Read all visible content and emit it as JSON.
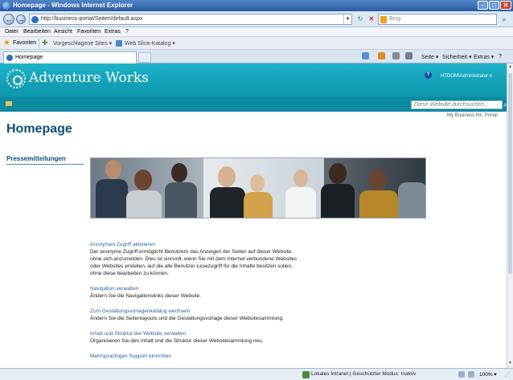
{
  "window": {
    "title": "Homepage - Windows Internet Explorer",
    "minimize": "–",
    "maximize": "□",
    "close": "✕"
  },
  "address_bar": {
    "back_icon": "←",
    "forward_icon": "→",
    "url": "http://business-portal/Seiten/default.aspx",
    "search_placeholder": "Bing",
    "refresh_icon": "↻",
    "stop_icon": "✕",
    "search_go_icon": "⌕"
  },
  "menu": [
    "Datei",
    "Bearbeiten",
    "Ansicht",
    "Favoriten",
    "Extras",
    "?"
  ],
  "favorites_bar": {
    "favorites_label": "Favoriten",
    "suggested_sites": "Vorgeschlagene Sites ▾",
    "web_slice": "Web Slice-Katalog ▾"
  },
  "tab": {
    "label": "Homepage"
  },
  "command_bar": {
    "page": "Seite ▾",
    "safety": "Sicherheit ▾",
    "tools": "Extras ▾",
    "help": "?"
  },
  "site": {
    "name": "Adventure Works",
    "user": "HTDOM\\Administrator ▾",
    "help_icon": "?",
    "search_placeholder": "Diese Website durchsuchen...",
    "search_go_icon": "⌕",
    "portal_link": "My Business Inc. Portal",
    "page_title": "Homepage",
    "left_nav_heading": "Pressemitteilungen"
  },
  "content_items": [
    {
      "heading": "Anonymen Zugriff aktivieren",
      "description": "Der anonyme Zugriff ermöglicht Benutzern das Anzeigen der Seiten auf dieser Website, ohne sich anzumelden. Dies ist sinnvoll, wenn Sie mit dem Internet verbundene Websites oder Websites erstellen, auf die alle Benutzer Lesezugriff für die Inhalte besitzen sollen, ohne diese bearbeiten zu können."
    },
    {
      "heading": "Navigation verwalten",
      "description": "Ändern Sie die Navigationslinks dieser Website."
    },
    {
      "heading": "Zum Gestaltungsvorlagenkatalog wechseln",
      "description": "Ändern Sie die Seitenlayouts und die Gestaltungsvorlage dieser Websitesammlung."
    },
    {
      "heading": "Inhalt und Struktur der Website verwalten",
      "description": "Organisieren Sie den Inhalt und die Struktur dieser Websitesammlung neu."
    },
    {
      "heading": "Mehrsprachigen Support einrichten",
      "description": ""
    }
  ],
  "status_bar": {
    "zone": "Lokales Intranet | Geschützter Modus: Inaktiv",
    "zoom": "100% ▾"
  },
  "colors": {
    "banner": "#1eb3c9",
    "banner_dark": "#0b8aa0",
    "title": "#0a4f74",
    "link": "#2a64a8"
  }
}
